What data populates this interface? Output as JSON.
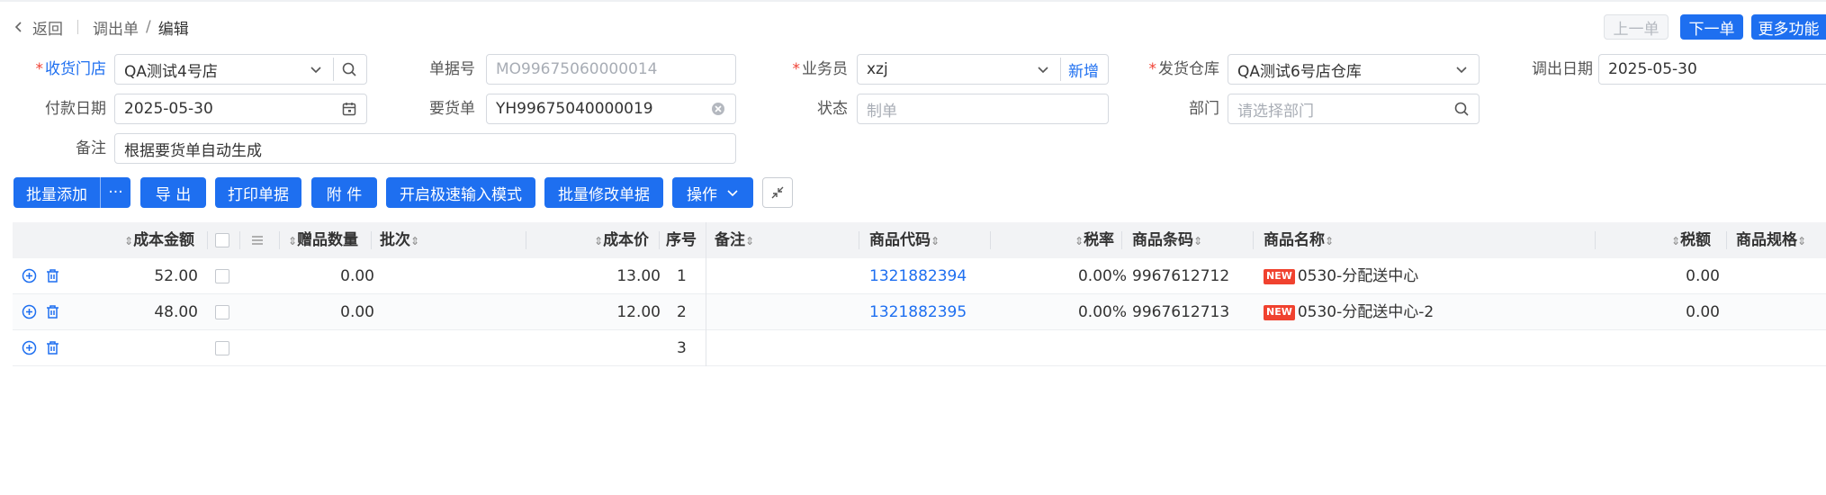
{
  "breadcrumb": {
    "back": "返回",
    "parent": "调出单",
    "current": "编辑"
  },
  "nav_buttons": {
    "prev": "上一单",
    "next": "下一单",
    "more": "更多功能"
  },
  "form": {
    "receiving_store": {
      "label": "收货门店",
      "value": "QA测试4号店"
    },
    "doc_no": {
      "label": "单据号",
      "placeholder": "MO99675060000014"
    },
    "salesperson": {
      "label": "业务员",
      "value": "xzj",
      "add": "新增"
    },
    "ship_warehouse": {
      "label": "发货仓库",
      "value": "QA测试6号店仓库"
    },
    "out_date": {
      "label": "调出日期",
      "value": "2025-05-30"
    },
    "pay_date": {
      "label": "付款日期",
      "value": "2025-05-30"
    },
    "request_no": {
      "label": "要货单",
      "value": "YH99675040000019"
    },
    "status": {
      "label": "状态",
      "placeholder": "制单"
    },
    "department": {
      "label": "部门",
      "placeholder": "请选择部门"
    },
    "remark": {
      "label": "备注",
      "value": "根据要货单自动生成"
    }
  },
  "toolbar": {
    "batch_add": "批量添加",
    "more": "···",
    "export": "导 出",
    "print": "打印单据",
    "attach": "附 件",
    "quick_input": "开启极速输入模式",
    "batch_edit": "批量修改单据",
    "operate": "操作"
  },
  "table": {
    "headers": {
      "cost_amount": "成本金额",
      "gift_qty": "赠品数量",
      "batch": "批次",
      "cost_price": "成本价",
      "seq": "序号",
      "remark": "备注",
      "code": "商品代码",
      "tax_rate": "税率",
      "barcode": "商品条码",
      "name": "商品名称",
      "tax": "税额",
      "spec": "商品规格"
    },
    "new_badge": "NEW",
    "rows": [
      {
        "cost_amount": "52.00",
        "gift_qty": "0.00",
        "cost_price": "13.00",
        "seq": "1",
        "code": "1321882394",
        "tax_rate": "0.00%",
        "barcode": "9967612712",
        "name": "0530-分配送中心",
        "tax": "0.00"
      },
      {
        "cost_amount": "48.00",
        "gift_qty": "0.00",
        "cost_price": "12.00",
        "seq": "2",
        "code": "1321882395",
        "tax_rate": "0.00%",
        "barcode": "9967612713",
        "name": "0530-分配送中心-2",
        "tax": "0.00"
      },
      {
        "seq": "3"
      }
    ]
  },
  "colors": {
    "primary": "#1e6ff0",
    "required": "#f04134",
    "badge": "#f0422f"
  }
}
